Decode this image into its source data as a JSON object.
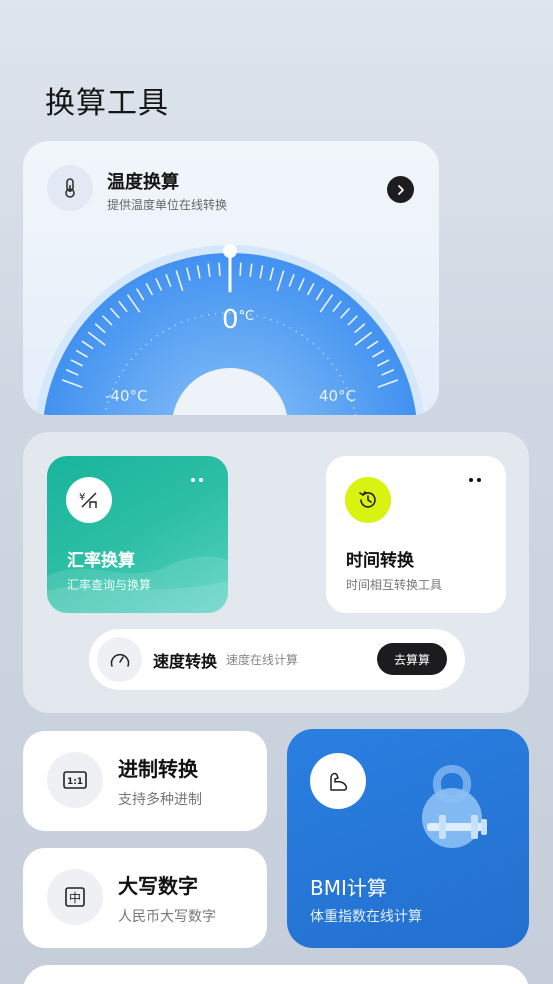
{
  "page": {
    "title": "换算工具"
  },
  "temperature": {
    "title": "温度换算",
    "subtitle": "提供温度单位在线转换",
    "icon": "thermometer-icon",
    "current_value": "0",
    "unit": "°C",
    "min_label": "-40°C",
    "max_label": "40°C",
    "accent": "#4a9cf0"
  },
  "exchange_rate": {
    "title": "汇率换算",
    "subtitle": "汇率查询与换算",
    "icon": "currency-icon",
    "color": "#1fb79f"
  },
  "time_convert": {
    "title": "时间转换",
    "subtitle": "时间相互转换工具",
    "icon": "history-icon",
    "icon_color": "#d9f20f"
  },
  "speed": {
    "title": "速度转换",
    "subtitle": "速度在线计算",
    "button_label": "去算算",
    "icon": "speedometer-icon"
  },
  "base_convert": {
    "title": "进制转换",
    "subtitle": "支持多种进制",
    "icon_text": "1:1"
  },
  "capital_numbers": {
    "title": "大写数字",
    "subtitle": "人民币大写数字",
    "icon_text": "中"
  },
  "bmi": {
    "title": "BMI计算",
    "subtitle": "体重指数在线计算",
    "icon": "flexed-arm-icon",
    "color": "#2677d8"
  }
}
